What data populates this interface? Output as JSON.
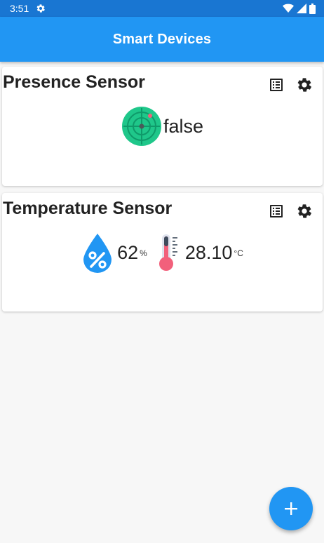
{
  "status_bar": {
    "time": "3:51",
    "icons": [
      "settings-icon",
      "wifi-icon",
      "signal-icon",
      "battery-icon"
    ]
  },
  "app_bar": {
    "title": "Smart Devices"
  },
  "devices": [
    {
      "name": "Presence Sensor",
      "icon": "radar-icon",
      "value": "false",
      "actions": [
        "list-icon",
        "gear-icon"
      ]
    },
    {
      "name": "Temperature Sensor",
      "readings": [
        {
          "icon": "humidity-drop-icon",
          "value": "62",
          "unit": "%"
        },
        {
          "icon": "thermometer-icon",
          "value": "28.10",
          "unit": "°C"
        }
      ],
      "actions": [
        "list-icon",
        "gear-icon"
      ]
    }
  ],
  "fab": {
    "icon": "plus-icon"
  },
  "colors": {
    "primary": "#2196f3",
    "status_bar": "#1976d2",
    "radar": "#1fc78a",
    "thermometer": "#f2607b"
  }
}
